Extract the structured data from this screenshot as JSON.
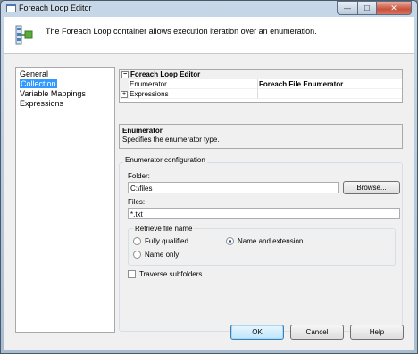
{
  "window": {
    "title": "Foreach Loop Editor",
    "min_glyph": "—",
    "max_glyph": "☐",
    "close_glyph": "✕"
  },
  "header": {
    "description": "The Foreach Loop container allows execution iteration over an enumeration."
  },
  "nav": {
    "items": [
      {
        "label": "General",
        "selected": false
      },
      {
        "label": "Collection",
        "selected": true
      },
      {
        "label": "Variable Mappings",
        "selected": false
      },
      {
        "label": "Expressions",
        "selected": false
      }
    ]
  },
  "grid": {
    "category": "Foreach Loop Editor",
    "category_toggle": "⊟",
    "rows": [
      {
        "name": "Enumerator",
        "value": "Foreach File Enumerator"
      },
      {
        "name": "Expressions",
        "value": "",
        "expander": "+"
      }
    ]
  },
  "help": {
    "title": "Enumerator",
    "text": "Specifies the enumerator type."
  },
  "config": {
    "group_label": "Enumerator configuration",
    "folder_label": "Folder:",
    "folder_value": "C:\\files",
    "browse_label": "Browse...",
    "files_label": "Files:",
    "files_value": "*.txt",
    "retrieve_label": "Retrieve file name",
    "options": [
      {
        "label": "Fully qualified",
        "checked": false
      },
      {
        "label": "Name and extension",
        "checked": true
      },
      {
        "label": "Name only",
        "checked": false
      }
    ],
    "traverse_label": "Traverse subfolders",
    "traverse_checked": false
  },
  "buttons": {
    "ok": "OK",
    "cancel": "Cancel",
    "help": "Help"
  }
}
